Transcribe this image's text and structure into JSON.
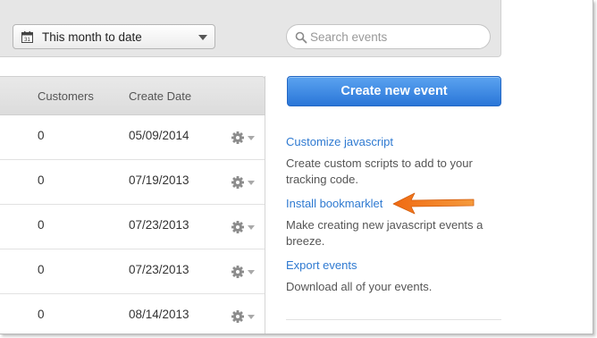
{
  "filters": {
    "date_range": "This month to date",
    "search_placeholder": "Search events",
    "search_value": ""
  },
  "table": {
    "columns": [
      "Customers",
      "Create Date"
    ],
    "rows": [
      {
        "customers": "0",
        "create_date": "05/09/2014"
      },
      {
        "customers": "0",
        "create_date": "07/19/2013"
      },
      {
        "customers": "0",
        "create_date": "07/23/2013"
      },
      {
        "customers": "0",
        "create_date": "07/23/2013"
      },
      {
        "customers": "0",
        "create_date": "08/14/2013"
      }
    ]
  },
  "sidebar": {
    "create_button": "Create new event",
    "customize_link": "Customize javascript",
    "customize_desc": "Create custom scripts to add to your tracking code.",
    "bookmarklet_link": "Install bookmarklet",
    "bookmarklet_desc": "Make creating new javascript events a breeze.",
    "export_link": "Export events",
    "export_desc": "Download all of your events."
  },
  "icons": {
    "calendar": "calendar-icon",
    "search": "search-icon",
    "gear": "gear-icon",
    "arrow": "arrow-annotation"
  },
  "colors": {
    "accent_button": "#2a76d8",
    "link": "#2f7ad1",
    "annotation_arrow": "#f07c1e"
  }
}
